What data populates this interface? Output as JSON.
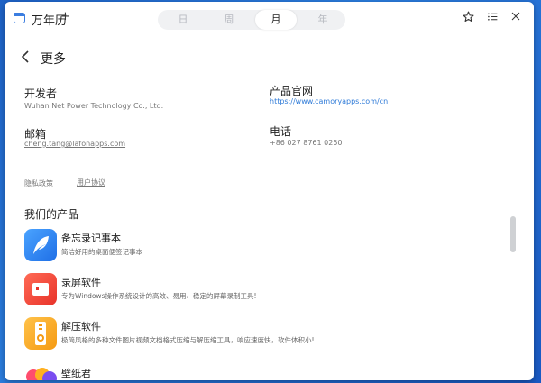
{
  "app": {
    "title": "万年历",
    "add": "+"
  },
  "view_tabs": [
    {
      "label": "日",
      "active": false
    },
    {
      "label": "周",
      "active": false
    },
    {
      "label": "月",
      "active": true
    },
    {
      "label": "年",
      "active": false
    }
  ],
  "toolbar_icons": {
    "favorite": "star-icon",
    "menu": "list-icon",
    "close": "close-icon"
  },
  "page": {
    "title": "更多"
  },
  "info": {
    "developer_label": "开发者",
    "developer_value": "Wuhan Net Power Technology Co., Ltd.",
    "website_label": "产品官网",
    "website_value": "https://www.camoryapps.com/cn",
    "email_label": "邮箱",
    "email_value": "cheng.tang@lafonapps.com",
    "phone_label": "电话",
    "phone_value": "+86 027 8761 0250"
  },
  "policies": {
    "privacy": "隐私政策",
    "agreement": "用户协议"
  },
  "products": {
    "section_title": "我们的产品",
    "items": [
      {
        "name": "备忘录记事本",
        "desc": "简洁好用的桌面便签记事本",
        "icon": "feather-icon",
        "color": "#2f86f0"
      },
      {
        "name": "录屏软件",
        "desc": "专为Windows操作系统设计的高效、易用、稳定的屏幕录制工具!",
        "icon": "record-icon",
        "color": "#f0463c"
      },
      {
        "name": "解压软件",
        "desc": "极简风格的多种文件图片视频文档格式压缩与解压缩工具，响应速度快，软件体积小!",
        "icon": "zip-icon",
        "color": "#f5a623"
      },
      {
        "name": "壁纸君",
        "desc": "",
        "icon": "wallpaper-icon",
        "color": "#e0408a"
      }
    ]
  }
}
